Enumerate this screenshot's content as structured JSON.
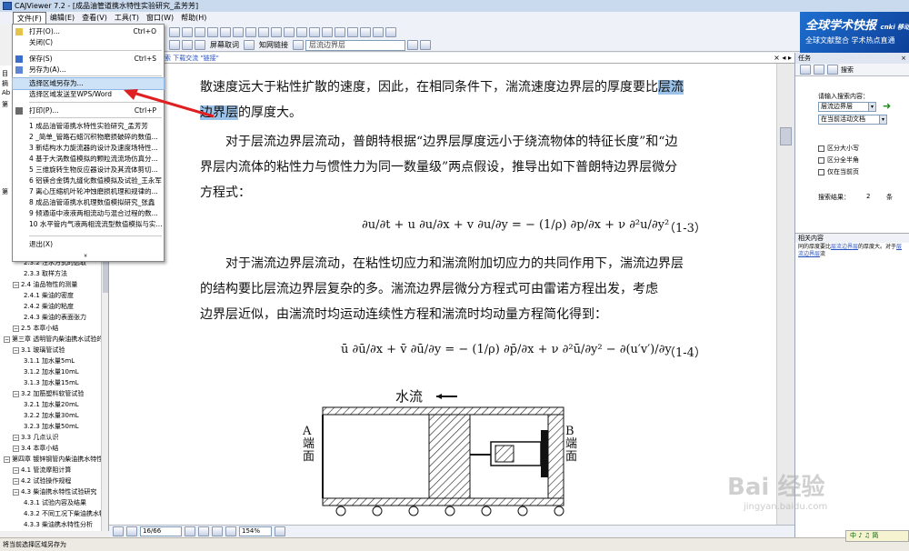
{
  "window": {
    "title": "CAJViewer 7.2 - [成品油管道携水特性实验研究_孟芳芳]"
  },
  "menubar": {
    "items": [
      "文件(F)",
      "编辑(E)",
      "查看(V)",
      "工具(T)",
      "窗口(W)",
      "帮助(H)"
    ],
    "active": "文件(F)"
  },
  "toolbar": {
    "select_text": "屏幕取词",
    "knowledge_link": "知网链接",
    "search_value": "层流边界层"
  },
  "banner": {
    "logo": "全球学术快报",
    "logo_sub": "cnki 移动版",
    "slogan": "全球文献整合 学术热点直通"
  },
  "docbar": {
    "text": "文献检索 下载交流 \"链接\""
  },
  "file_menu": {
    "items": [
      {
        "label": "打开(O)...",
        "shortcut": "Ctrl+O"
      },
      {
        "label": "关闭(C)",
        "shortcut": ""
      },
      {
        "label": "保存(S)",
        "shortcut": "Ctrl+S"
      },
      {
        "label": "另存为(A)...",
        "shortcut": ""
      },
      {
        "label": "选择区域另存为...",
        "shortcut": ""
      },
      {
        "label": "选择区域发送至WPS/Word",
        "shortcut": ""
      },
      {
        "label": "打印(P)...",
        "shortcut": "Ctrl+P"
      },
      {
        "label": "1 成品油管道携水特性实验研究_孟芳芳",
        "shortcut": ""
      },
      {
        "label": "2 _简单_管路石蜡沉积物磨损破碎的数值...",
        "shortcut": ""
      },
      {
        "label": "3 新结构水力旋流器的设计及速度场特性...",
        "shortcut": ""
      },
      {
        "label": "4 基于大涡数值模拟的颗粒流流场仿真分...",
        "shortcut": ""
      },
      {
        "label": "5 三维旋转生物反应器设计及其流体剪切...",
        "shortcut": ""
      },
      {
        "label": "6 铝镁合金铸九缝化数值模拟及试验_王永军",
        "shortcut": ""
      },
      {
        "label": "7 离心压缩机叶轮冲蚀磨损机理和规律的...",
        "shortcut": ""
      },
      {
        "label": "8 成品油管道携水机理数值模拟研究_张鑫",
        "shortcut": ""
      },
      {
        "label": "9 倾通道中液液两相流动与混合过程的数...",
        "shortcut": ""
      },
      {
        "label": "10 水平管内气液两相流流型数值模拟与实...",
        "shortcut": ""
      },
      {
        "label": "退出(X)",
        "shortcut": ""
      }
    ],
    "hovered": "选择区域另存为..."
  },
  "outline": {
    "top_labels": [
      "目",
      "摘",
      "Ab",
      "第",
      "",
      "第"
    ],
    "items": [
      {
        "label": "2.3.2 注水方式的选取",
        "level": 2
      },
      {
        "label": "2.3.3 取样方法",
        "level": 2
      },
      {
        "label": "2.4 油品物性的测量",
        "level": 1
      },
      {
        "label": "2.4.1 柴油的密度",
        "level": 2
      },
      {
        "label": "2.4.2 柴油的粘度",
        "level": 2
      },
      {
        "label": "2.4.3 柴油的表面张力",
        "level": 2
      },
      {
        "label": "2.5 本章小结",
        "level": 1
      },
      {
        "label": "第三章 透明管内柴油携水试验的研",
        "level": 0
      },
      {
        "label": "3.1 玻璃管试验",
        "level": 1
      },
      {
        "label": "3.1.1 加水量5mL",
        "level": 2
      },
      {
        "label": "3.1.2 加水量10mL",
        "level": 2
      },
      {
        "label": "3.1.3 加水量15mL",
        "level": 2
      },
      {
        "label": "3.2 加筋塑料软管试验",
        "level": 1
      },
      {
        "label": "3.2.1 加水量20mL",
        "level": 2
      },
      {
        "label": "3.2.2 加水量30mL",
        "level": 2
      },
      {
        "label": "3.2.3 加水量50mL",
        "level": 2
      },
      {
        "label": "3.3 几点认识",
        "level": 1
      },
      {
        "label": "3.4 本章小结",
        "level": 1
      },
      {
        "label": "第四章 镀锌钢管内柴油携水特性研",
        "level": 0
      },
      {
        "label": "4.1 管流摩阻计算",
        "level": 1
      },
      {
        "label": "4.2 试验操作规程",
        "level": 1
      },
      {
        "label": "4.3 柴油携水特性试验研究",
        "level": 1
      },
      {
        "label": "4.3.1 试验内容及结果",
        "level": 2
      },
      {
        "label": "4.3.2 不同工况下柴油携水特",
        "level": 2
      },
      {
        "label": "4.3.3 柴油携水特性分析",
        "level": 2
      }
    ]
  },
  "document": {
    "line1a": "散速度远大于粘性扩散的速度，因此，在相同条件下，湍流速度边界层的厚度要比",
    "line1hl": "层流",
    "line2hl": "边界层",
    "line2b": "的厚度大。",
    "para2": [
      "　　对于层流边界层流动，普朗特根据“边界层厚度远小于绕流物体的特征长度”和“边",
      "界层内流体的粘性力与惯性力为同一数量级”两点假设，推导出如下普朗特边界层微分",
      "方程式："
    ],
    "eq1": "∂u/∂t + u ∂u/∂x + v ∂u/∂y = − (1/ρ) ∂p/∂x + ν ∂²u/∂y²",
    "eq1_num": "（1-3）",
    "para3": [
      "　　对于湍流边界层流动，在粘性切应力和湍流附加切应力的共同作用下，湍流边界层",
      "的结构要比层流边界层复杂的多。湍流边界层微分方程式可由雷诺方程出发，考虑",
      "边界层近似，由湍流时均运动连续性方程和湍流时均动量方程简化得到："
    ],
    "eq2": "ū ∂ū/∂x + v̄ ∂ū/∂y = − (1/ρ) ∂p̄/∂x + ν ∂²ū/∂y² − ∂(u′v′)/∂y",
    "eq2_num": "（1-4）",
    "fig_flow": "水流",
    "fig_a": "A端面",
    "fig_b": "B端面"
  },
  "bottombar": {
    "page": "16/66",
    "zoom": "154%"
  },
  "statusbar": {
    "text": "将当前选择区域另存为"
  },
  "rightpanel": {
    "header": "任务",
    "tab": "搜索",
    "prompt": "请输入搜索内容：",
    "query": "层流边界层",
    "scope": "在当前活动文档",
    "opt1": "区分大小写",
    "opt2": "区分全半角",
    "opt3": "仅在当前页",
    "result_label": "搜索结果：",
    "result_count": "2",
    "result_unit": "条",
    "related_header": "相关内容",
    "related_text1": "同的厚度要比",
    "related_link1": "层流边界层",
    "related_text2": "的厚度大。对于",
    "related_link2": "层流边界层",
    "related_text3": "流"
  },
  "watermark": {
    "text": "Bai 经验",
    "url": "jingyan.baidu.com"
  },
  "tray": {
    "text": "中 ♪ ♫ 简"
  }
}
